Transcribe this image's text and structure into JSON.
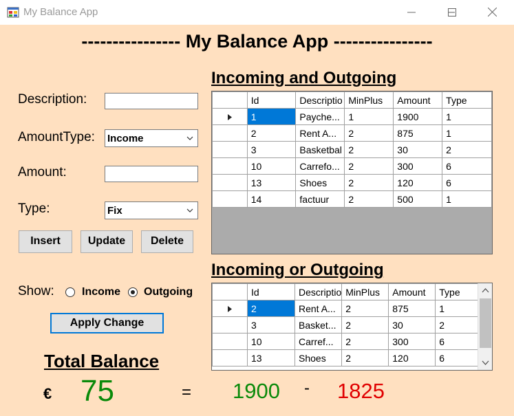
{
  "window": {
    "title": "My Balance App",
    "heading": "---------------- My Balance App ----------------",
    "icon": "app-window-icon"
  },
  "form": {
    "description_label": "Description:",
    "description_value": "",
    "amount_type_label": "AmountType:",
    "amount_type_value": "Income",
    "amount_label": "Amount:",
    "amount_value": "",
    "type_label": "Type:",
    "type_value": "Fix"
  },
  "buttons": {
    "insert": "Insert",
    "update": "Update",
    "delete": "Delete",
    "apply_change": "Apply Change"
  },
  "show": {
    "label": "Show:",
    "income": "Income",
    "outgoing": "Outgoing",
    "selected": "Outgoing"
  },
  "grid_all": {
    "title": "Incoming and Outgoing",
    "columns": [
      "Id",
      "Descriptio",
      "MinPlus",
      "Amount",
      "Type"
    ],
    "rows": [
      [
        "1",
        "Payche...",
        "1",
        "1900",
        "1"
      ],
      [
        "2",
        "Rent A...",
        "2",
        "875",
        "1"
      ],
      [
        "3",
        "Basketbal",
        "2",
        "30",
        "2"
      ],
      [
        "10",
        "Carrefo...",
        "2",
        "300",
        "6"
      ],
      [
        "13",
        "Shoes",
        "2",
        "120",
        "6"
      ],
      [
        "14",
        "factuur",
        "2",
        "500",
        "1"
      ]
    ]
  },
  "grid_filtered": {
    "title": "Incoming or Outgoing",
    "columns": [
      "Id",
      "Descriptio",
      "MinPlus",
      "Amount",
      "Type"
    ],
    "rows": [
      [
        "2",
        "Rent A...",
        "2",
        "875",
        "1"
      ],
      [
        "3",
        "Basket...",
        "2",
        "30",
        "2"
      ],
      [
        "10",
        "Carref...",
        "2",
        "300",
        "6"
      ],
      [
        "13",
        "Shoes",
        "2",
        "120",
        "6"
      ]
    ]
  },
  "balance": {
    "title": "Total Balance",
    "currency": "€",
    "total": "75",
    "equals": "=",
    "income": "1900",
    "minus": "-",
    "outgoing": "1825"
  },
  "colors": {
    "background": "#ffe0c0",
    "positive": "#0a8a0a",
    "negative": "#e00000",
    "selection": "#0078d7"
  }
}
